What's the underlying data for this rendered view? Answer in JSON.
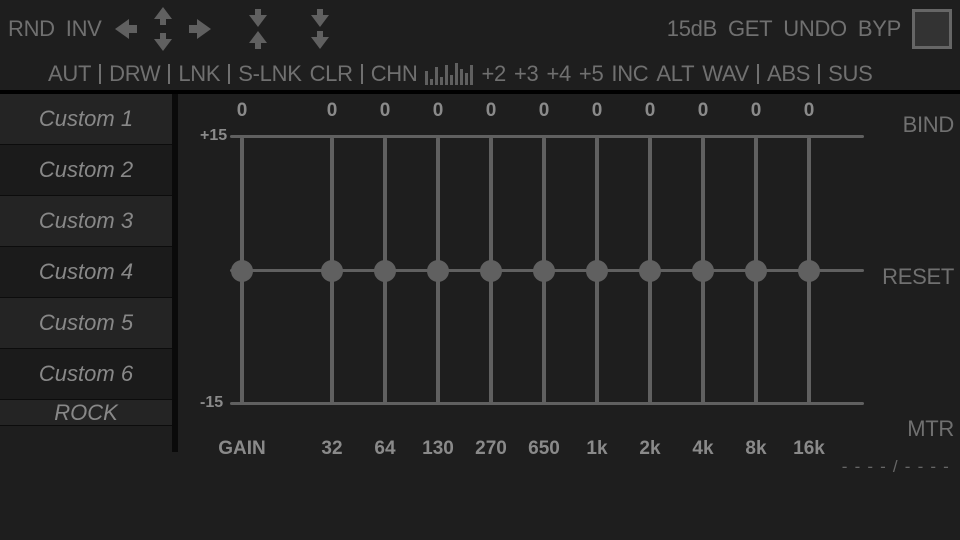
{
  "toolbar": {
    "rnd": "RND",
    "inv": "INV",
    "db_label": "15dB",
    "get": "GET",
    "undo": "UNDO",
    "byp": "BYP"
  },
  "dbrow": {
    "aut": "AUT",
    "drw": "DRW",
    "lnk": "LNK",
    "slnk": "S-LNK",
    "clr": "CLR",
    "chn": "CHN",
    "plus2": "+2",
    "plus3": "+3",
    "plus4": "+4",
    "plus5": "+5",
    "inc": "INC",
    "alt": "ALT",
    "wav": "WAV",
    "abs": "ABS",
    "sus": "SUS"
  },
  "presets": {
    "items": [
      {
        "label": "Custom 1"
      },
      {
        "label": "Custom 2"
      },
      {
        "label": "Custom 3"
      },
      {
        "label": "Custom 4"
      },
      {
        "label": "Custom 5"
      },
      {
        "label": "Custom 6"
      },
      {
        "label": "ROCK"
      }
    ]
  },
  "eq": {
    "axis_top": "+15",
    "axis_bot": "-15",
    "gain_label": "GAIN",
    "bands": [
      {
        "value": "0",
        "freq": "GAIN"
      },
      {
        "value": "0",
        "freq": "32"
      },
      {
        "value": "0",
        "freq": "64"
      },
      {
        "value": "0",
        "freq": "130"
      },
      {
        "value": "0",
        "freq": "270"
      },
      {
        "value": "0",
        "freq": "650"
      },
      {
        "value": "0",
        "freq": "1k"
      },
      {
        "value": "0",
        "freq": "2k"
      },
      {
        "value": "0",
        "freq": "4k"
      },
      {
        "value": "0",
        "freq": "8k"
      },
      {
        "value": "0",
        "freq": "16k"
      }
    ],
    "right": {
      "bind": "BIND",
      "reset": "RESET",
      "mtr": "MTR"
    }
  },
  "footer": {
    "time": "- - - - / - - - -"
  }
}
